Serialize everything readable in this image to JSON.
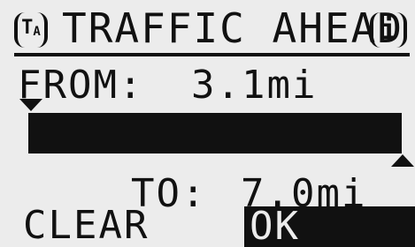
{
  "header": {
    "ta_badge": "T",
    "ta_badge_sub": "A",
    "title": "TRAFFIC AHEAD",
    "info_icon_text": "i"
  },
  "range": {
    "from_label": "FROM:",
    "from_value": "3.1mi",
    "to_label": "TO:",
    "to_value": "7.0mi"
  },
  "buttons": {
    "clear_label": "CLEAR",
    "ok_label": "OK"
  },
  "colors": {
    "background": "#ececec",
    "foreground": "#111111"
  },
  "icons": [
    "traffic-announcement-icon",
    "info-icon",
    "range-start-marker-icon",
    "range-end-marker-icon"
  ]
}
